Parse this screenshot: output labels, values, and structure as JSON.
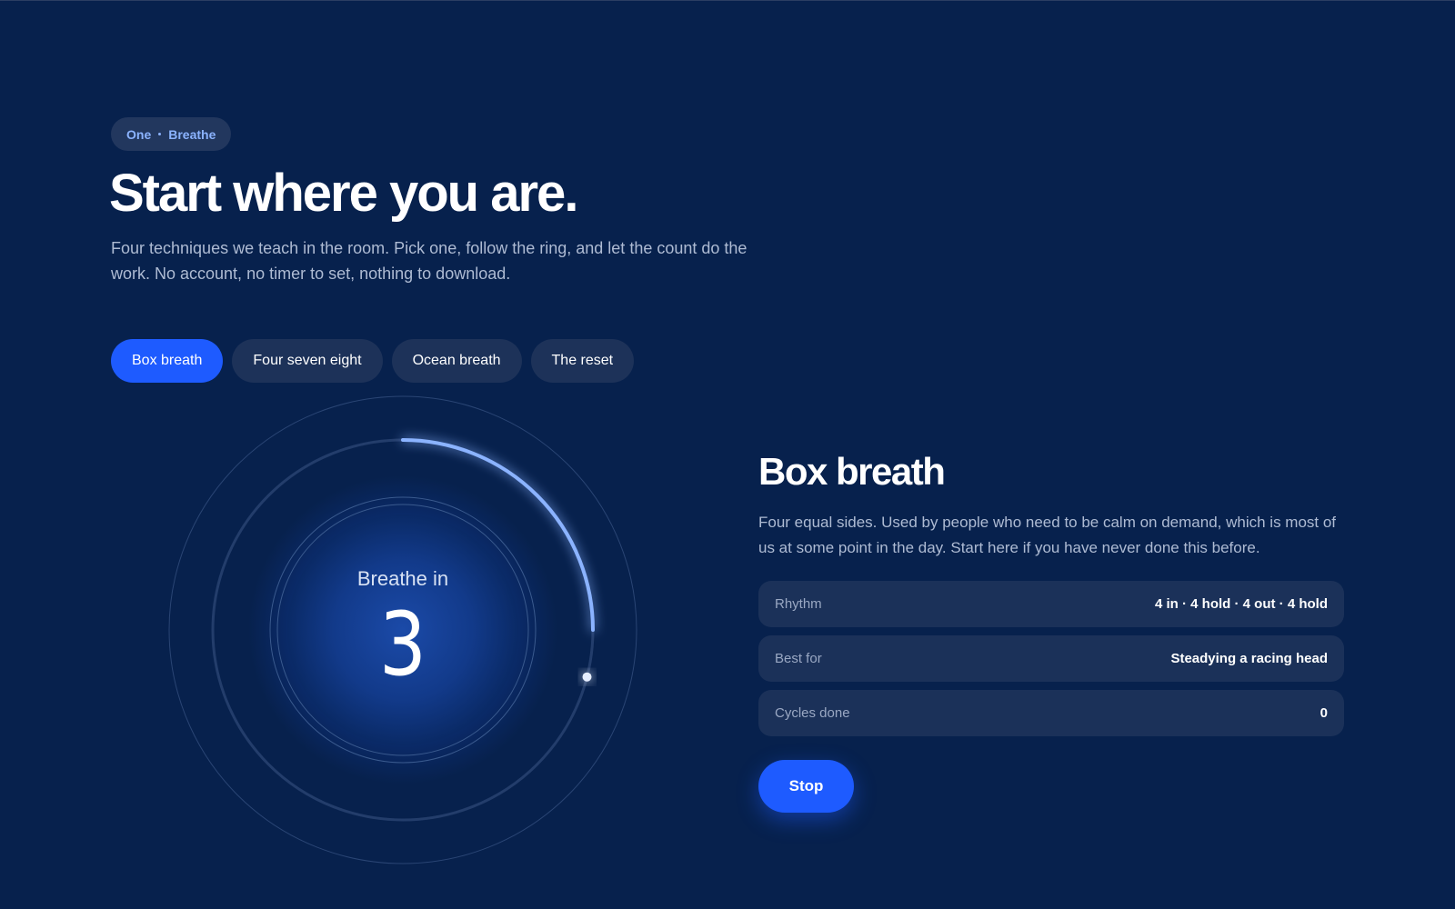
{
  "eyebrow": {
    "part1": "One",
    "part2": "Breathe"
  },
  "page_title": "Start where you are.",
  "intro": "Four techniques we teach in the room. Pick one, follow the ring, and let the count do the work. No account, no timer to set, nothing to download.",
  "tabs": [
    {
      "label": "Box breath",
      "active": true
    },
    {
      "label": "Four seven eight",
      "active": false
    },
    {
      "label": "Ocean breath",
      "active": false
    },
    {
      "label": "The reset",
      "active": false
    }
  ],
  "ring": {
    "phase_label": "Breathe in",
    "count": "3",
    "phase_progress": 0.25,
    "accent_color": "#8bb3ff"
  },
  "detail": {
    "title": "Box breath",
    "description": "Four equal sides. Used by people who need to be calm on demand, which is most of us at some point in the day. Start here if you have never done this before.",
    "facts": [
      {
        "label": "Rhythm",
        "value": "4 in · 4 hold · 4 out · 4 hold"
      },
      {
        "label": "Best for",
        "value": "Steadying a racing head"
      },
      {
        "label": "Cycles done",
        "value": "0"
      }
    ],
    "stop_label": "Stop"
  },
  "colors": {
    "background": "#07214d",
    "accent": "#1e5bff",
    "chip_bg": "#1d3259",
    "eyebrow_text": "#8bb3ff"
  }
}
